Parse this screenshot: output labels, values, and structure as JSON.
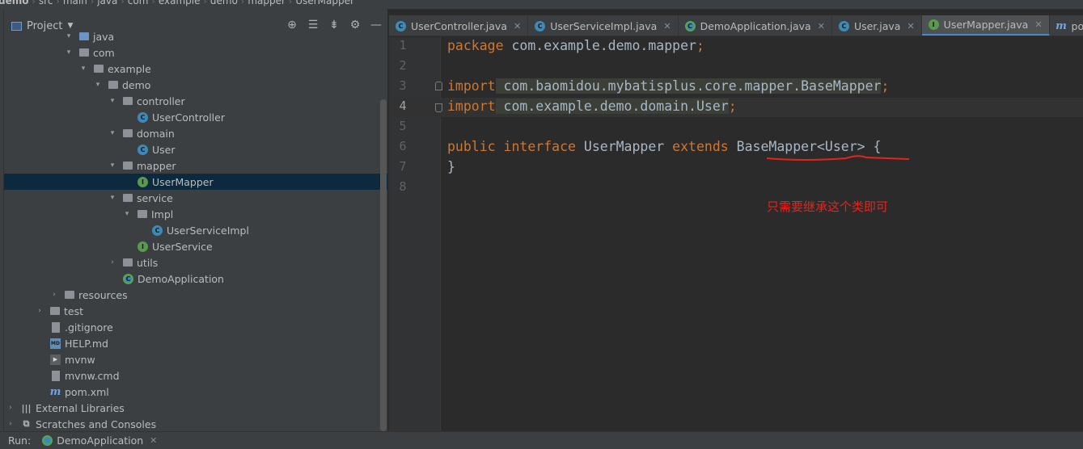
{
  "breadcrumb": [
    "demo",
    "src",
    "main",
    "java",
    "com",
    "example",
    "demo",
    "mapper",
    "UserMapper"
  ],
  "project_panel": {
    "title": "Project",
    "tools": [
      "target-icon",
      "expand-all-icon",
      "collapse-all-icon",
      "gear-icon",
      "minimize-icon"
    ]
  },
  "tree": [
    {
      "label": "java",
      "icon": "folder-blue",
      "arrow": "down"
    },
    {
      "label": "com",
      "icon": "folder",
      "arrow": "down"
    },
    {
      "label": "example",
      "icon": "folder",
      "arrow": "down"
    },
    {
      "label": "demo",
      "icon": "folder",
      "arrow": "down"
    },
    {
      "label": "controller",
      "icon": "folder",
      "arrow": "down"
    },
    {
      "label": "UserController",
      "icon": "class",
      "arrow": "none"
    },
    {
      "label": "domain",
      "icon": "folder",
      "arrow": "down"
    },
    {
      "label": "User",
      "icon": "class",
      "arrow": "none"
    },
    {
      "label": "mapper",
      "icon": "folder",
      "arrow": "down"
    },
    {
      "label": "UserMapper",
      "icon": "interface",
      "arrow": "none",
      "selected": true
    },
    {
      "label": "service",
      "icon": "folder",
      "arrow": "down"
    },
    {
      "label": "Impl",
      "icon": "folder",
      "arrow": "down"
    },
    {
      "label": "UserServiceImpl",
      "icon": "class",
      "arrow": "none"
    },
    {
      "label": "UserService",
      "icon": "interface",
      "arrow": "none"
    },
    {
      "label": "utils",
      "icon": "folder",
      "arrow": "right"
    },
    {
      "label": "DemoApplication",
      "icon": "app",
      "arrow": "none"
    },
    {
      "label": "resources",
      "icon": "folder",
      "arrow": "right"
    },
    {
      "label": "test",
      "icon": "folder",
      "arrow": "right"
    },
    {
      "label": ".gitignore",
      "icon": "file",
      "arrow": "none"
    },
    {
      "label": "HELP.md",
      "icon": "md",
      "arrow": "none"
    },
    {
      "label": "mvnw",
      "icon": "terminal",
      "arrow": "none"
    },
    {
      "label": "mvnw.cmd",
      "icon": "file",
      "arrow": "none"
    },
    {
      "label": "pom.xml",
      "icon": "maven",
      "arrow": "none"
    },
    {
      "label": "External Libraries",
      "icon": "library",
      "arrow": "right"
    },
    {
      "label": "Scratches and Consoles",
      "icon": "scratch",
      "arrow": "right"
    }
  ],
  "tabs": [
    {
      "label": "UserController.java",
      "icon": "C",
      "kind": "c"
    },
    {
      "label": "UserServiceImpl.java",
      "icon": "C",
      "kind": "c"
    },
    {
      "label": "DemoApplication.java",
      "icon": "C",
      "kind": "a"
    },
    {
      "label": "User.java",
      "icon": "C",
      "kind": "c"
    },
    {
      "label": "UserMapper.java",
      "icon": "I",
      "kind": "i",
      "active": true
    },
    {
      "label": "pom.xml (de",
      "icon": "m",
      "kind": "m"
    }
  ],
  "editor": {
    "line_numbers": [
      "1",
      "2",
      "3",
      "4",
      "5",
      "6",
      "7",
      "8"
    ],
    "current_line": "4",
    "lines": {
      "l1_kw": "package",
      "l1_rest": " com.example.demo.mapper",
      "l1_semi": ";",
      "l3_kw": "import",
      "l3_rest": " com.baomidou.mybatisplus.core.mapper.BaseMapper",
      "l3_semi": ";",
      "l4_kw": "import",
      "l4_rest": " com.example.demo.domain.User",
      "l4_semi": ";",
      "l6_kw1": "public",
      "l6_kw2": "interface",
      "l6_name": "UserMapper",
      "l6_kw3": "extends",
      "l6_type": "BaseMapper<User>",
      "l6_brace": "{",
      "l7": "}"
    },
    "annotation": "只需要继承这个类即可",
    "annotation_color": "#e8231c"
  },
  "runbar": {
    "label": "Run:",
    "tab": "DemoApplication"
  },
  "colors": {
    "keyword": "#cc7832",
    "text": "#a9b7c6",
    "selection": "#0d293e",
    "active_tab_accent": "#4a88c7"
  }
}
